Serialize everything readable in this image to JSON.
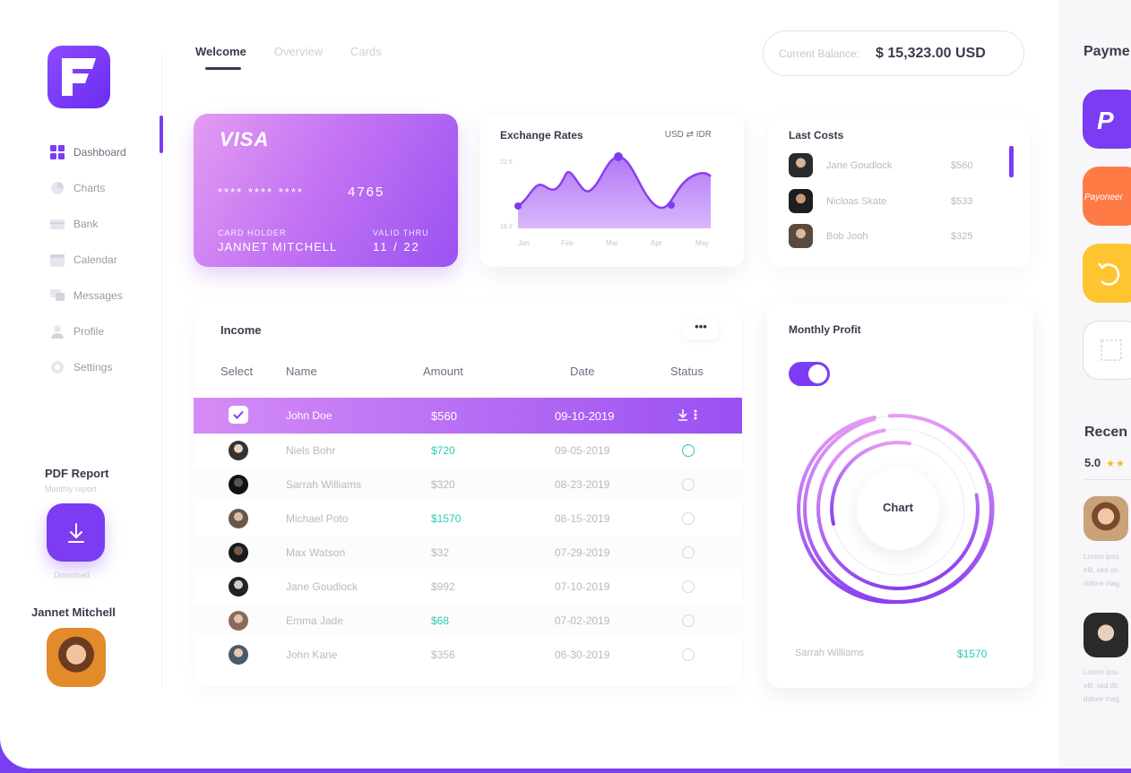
{
  "nav": {
    "items": [
      {
        "label": "Dashboard",
        "icon": "dashboard-icon"
      },
      {
        "label": "Charts",
        "icon": "pie-chart-icon"
      },
      {
        "label": "Bank",
        "icon": "bank-card-icon"
      },
      {
        "label": "Calendar",
        "icon": "calendar-icon"
      },
      {
        "label": "Messages",
        "icon": "messages-icon"
      },
      {
        "label": "Profile",
        "icon": "profile-icon"
      },
      {
        "label": "Settings",
        "icon": "gear-icon"
      }
    ]
  },
  "report": {
    "title": "PDF Report",
    "subtitle": "Monthly report",
    "download_label": "Download"
  },
  "user": {
    "name": "Jannet Mitchell"
  },
  "tabs": [
    "Welcome",
    "Overview",
    "Cards"
  ],
  "balance": {
    "label": "Current Balance:",
    "value": "$ 15,323.00 USD"
  },
  "card": {
    "brand": "VISA",
    "masked": "**** **** ****",
    "last4": "4765",
    "holder_label": "CARD HOLDER",
    "holder": "JANNET MITCHELL",
    "valid_label": "VALID THRU",
    "valid": "11 / 22"
  },
  "exchange": {
    "title": "Exchange Rates",
    "pair_from": "USD",
    "pair_to": "IDR",
    "y_top": "22.5",
    "y_bottom": "18.2",
    "months": [
      "Jan",
      "Feb",
      "Mar",
      "Apr",
      "May"
    ]
  },
  "last_costs": {
    "title": "Last Costs",
    "rows": [
      {
        "name": "Jane Goudlock",
        "amount": "$560"
      },
      {
        "name": "Nicloas Skate",
        "amount": "$533"
      },
      {
        "name": "Bob Jooh",
        "amount": "$325"
      }
    ]
  },
  "income": {
    "title": "Income",
    "more": "•••",
    "headers": {
      "select": "Select",
      "name": "Name",
      "amount": "Amount",
      "date": "Date",
      "status": "Status"
    },
    "rows": [
      {
        "name": "John Doe",
        "amount": "$560",
        "date": "09-10-2019"
      },
      {
        "name": "Niels Bohr",
        "amount": "$720",
        "date": "09-05-2019"
      },
      {
        "name": "Sarrah Williams",
        "amount": "$320",
        "date": "08-23-2019"
      },
      {
        "name": "Michael Poto",
        "amount": "$1570",
        "date": "08-15-2019"
      },
      {
        "name": "Max Watson",
        "amount": "$32",
        "date": "07-29-2019"
      },
      {
        "name": "Jane Goudlock",
        "amount": "$992",
        "date": "07-10-2019"
      },
      {
        "name": "Emma Jade",
        "amount": "$68",
        "date": "07-02-2019"
      },
      {
        "name": "John Kane",
        "amount": "$356",
        "date": "06-30-2019"
      }
    ]
  },
  "profit": {
    "title": "Monthly Profit",
    "toggle_on": true,
    "center_label": "Chart",
    "footer_name": "Sarrah Williams",
    "footer_amount": "$1570"
  },
  "payments": {
    "title": "Payme",
    "tiles": [
      "paypal-icon",
      "payoneer-icon",
      "refresh-icon",
      "scan-icon"
    ],
    "payoneer_text": "Payoneer"
  },
  "reviews": {
    "title": "Recen",
    "rating": "5.0",
    "stars": "★★",
    "items": [
      {
        "text": [
          "Lorem ipsu",
          "elit, sed do",
          "dolore mag"
        ]
      },
      {
        "text": [
          "Lorem ipsu",
          "elit, sed do",
          "dolore mag"
        ]
      }
    ]
  },
  "colors": {
    "accent": "#7c3cf3",
    "green": "#2fc9b4",
    "orange": "#ff7a45",
    "yellow": "#ffc531"
  }
}
